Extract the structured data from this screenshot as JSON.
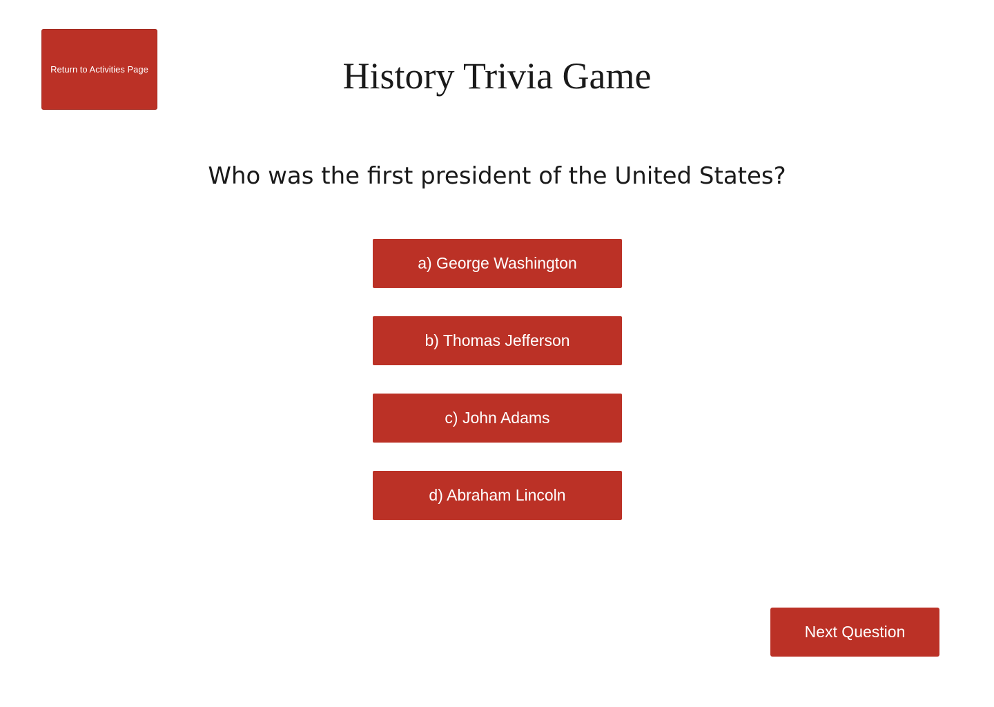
{
  "header": {
    "back_button_label": "Return to Activities Page",
    "title": "History Trivia Game"
  },
  "quiz": {
    "question": "Who was the first president of the United States?",
    "answers": [
      {
        "label": "a) George Washington"
      },
      {
        "label": "b) Thomas Jefferson"
      },
      {
        "label": "c) John Adams"
      },
      {
        "label": "d) Abraham Lincoln"
      }
    ],
    "next_button_label": "Next Question"
  },
  "colors": {
    "accent": "#bb3126",
    "background": "#ffffff",
    "text": "#1a1a1a"
  }
}
